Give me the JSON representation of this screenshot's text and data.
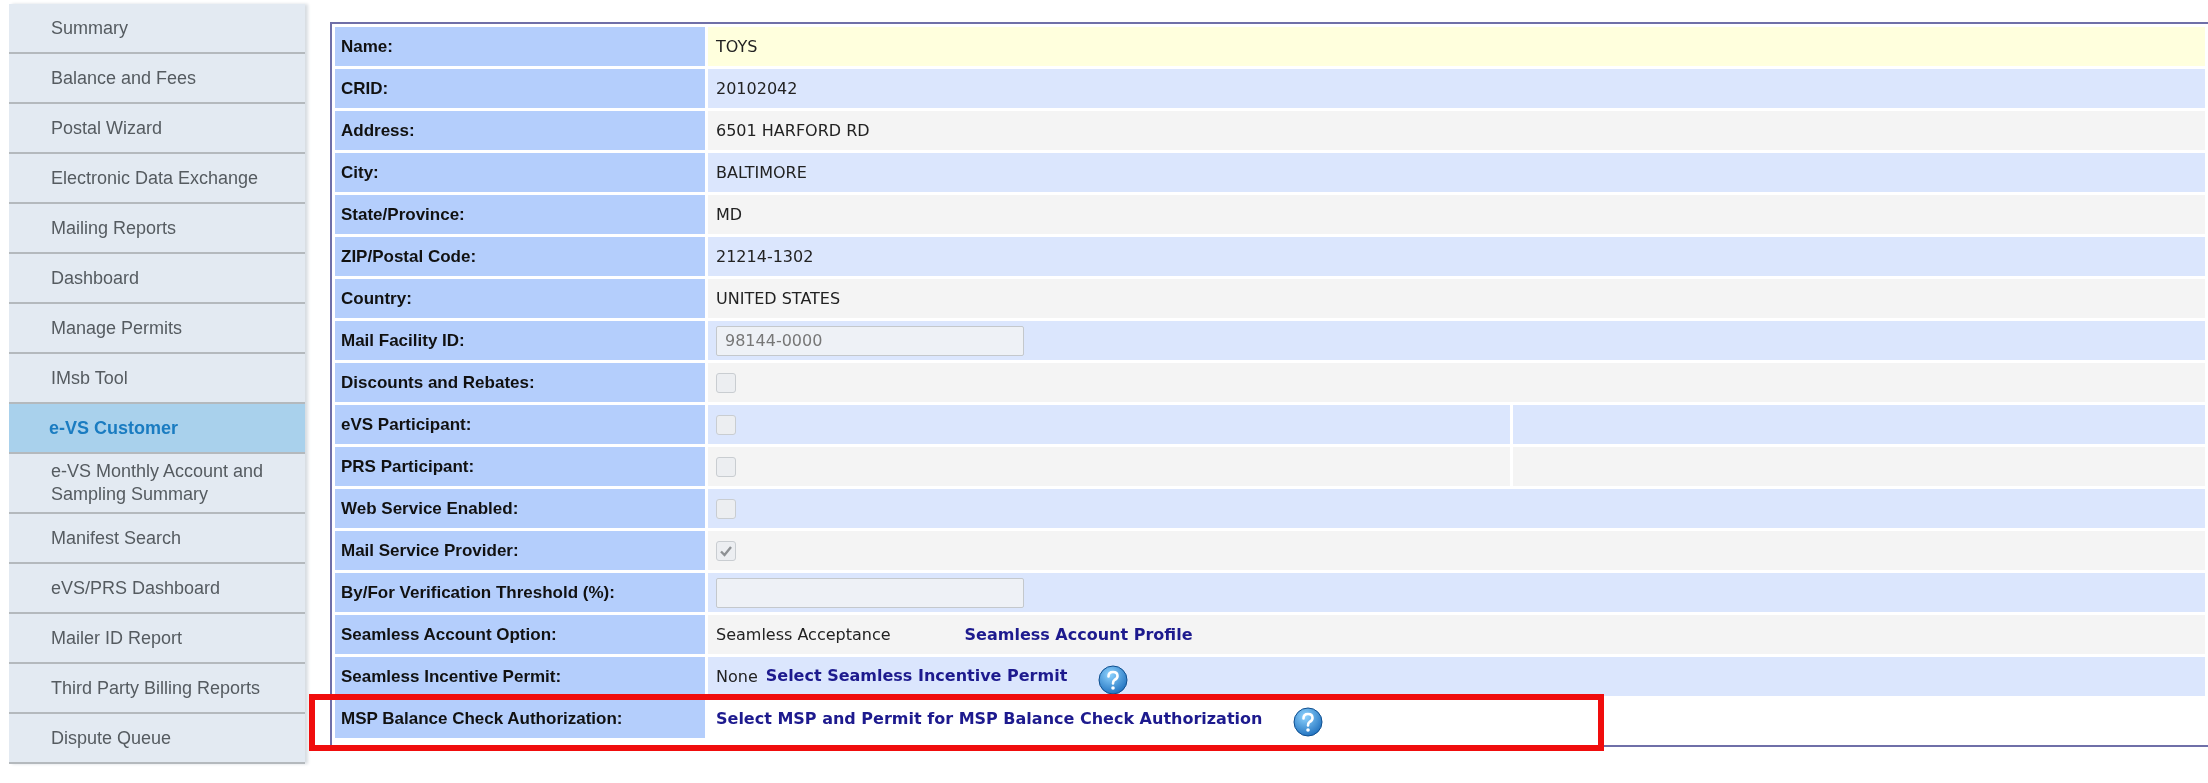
{
  "sidebar": {
    "items": [
      {
        "label": "Summary",
        "selected": false
      },
      {
        "label": "Balance and Fees",
        "selected": false
      },
      {
        "label": "Postal Wizard",
        "selected": false
      },
      {
        "label": "Electronic Data Exchange",
        "selected": false
      },
      {
        "label": "Mailing Reports",
        "selected": false
      },
      {
        "label": "Dashboard",
        "selected": false
      },
      {
        "label": "Manage Permits",
        "selected": false
      },
      {
        "label": "IMsb Tool",
        "selected": false
      },
      {
        "label": "e-VS Customer",
        "selected": true
      },
      {
        "label": "e-VS Monthly Account and Sampling Summary",
        "selected": false
      },
      {
        "label": "Manifest Search",
        "selected": false
      },
      {
        "label": "eVS/PRS Dashboard",
        "selected": false
      },
      {
        "label": "Mailer ID Report",
        "selected": false
      },
      {
        "label": "Third Party Billing Reports",
        "selected": false
      },
      {
        "label": "Dispute Queue",
        "selected": false
      }
    ]
  },
  "details": {
    "rows": [
      {
        "label": "Name:",
        "kind": "text",
        "value": "TOYS"
      },
      {
        "label": "CRID:",
        "kind": "text",
        "value": "20102042"
      },
      {
        "label": "Address:",
        "kind": "text",
        "value": "6501 HARFORD RD"
      },
      {
        "label": "City:",
        "kind": "text",
        "value": "BALTIMORE"
      },
      {
        "label": "State/Province:",
        "kind": "text",
        "value": "MD"
      },
      {
        "label": "ZIP/Postal Code:",
        "kind": "text",
        "value": "21214-1302"
      },
      {
        "label": "Country:",
        "kind": "text",
        "value": "UNITED STATES"
      },
      {
        "label": "Mail Facility ID:",
        "kind": "input",
        "value": "98144-0000"
      },
      {
        "label": "Discounts and Rebates:",
        "kind": "checkbox",
        "checked": false
      },
      {
        "label": "eVS Participant:",
        "kind": "checkbox",
        "checked": false,
        "split": true
      },
      {
        "label": "PRS Participant:",
        "kind": "checkbox",
        "checked": false,
        "split": true
      },
      {
        "label": "Web Service Enabled:",
        "kind": "checkbox",
        "checked": false
      },
      {
        "label": "Mail Service Provider:",
        "kind": "checkbox",
        "checked": true
      },
      {
        "label": "By/For Verification Threshold (%):",
        "kind": "input"
      },
      {
        "label": "Seamless Account Option:",
        "kind": "links",
        "value": "Seamless Acceptance",
        "link": "Seamless Account Profile",
        "help": false
      },
      {
        "label": "Seamless Incentive Permit:",
        "kind": "links",
        "value": "None",
        "link": "Select Seamless Incentive Permit",
        "help": true
      },
      {
        "label": "MSP Balance Check Authorization:",
        "kind": "links",
        "link": "Select MSP and Permit for MSP Balance Check Authorization",
        "help": true,
        "highlighted": true
      }
    ]
  }
}
